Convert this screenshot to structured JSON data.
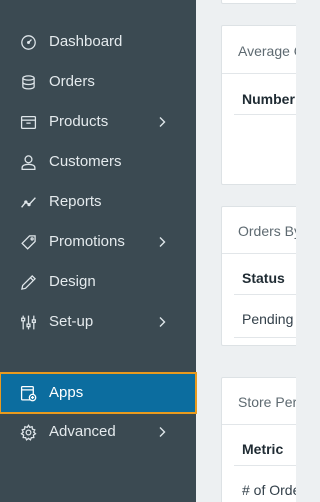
{
  "sidebar": {
    "items": [
      {
        "label": "Dashboard",
        "icon": "dashboard-icon",
        "has_submenu": false
      },
      {
        "label": "Orders",
        "icon": "orders-icon",
        "has_submenu": false
      },
      {
        "label": "Products",
        "icon": "products-icon",
        "has_submenu": true
      },
      {
        "label": "Customers",
        "icon": "customers-icon",
        "has_submenu": false
      },
      {
        "label": "Reports",
        "icon": "reports-icon",
        "has_submenu": false
      },
      {
        "label": "Promotions",
        "icon": "promotions-icon",
        "has_submenu": true
      },
      {
        "label": "Design",
        "icon": "design-icon",
        "has_submenu": false
      },
      {
        "label": "Set-up",
        "icon": "setup-icon",
        "has_submenu": true
      },
      {
        "label": "Apps",
        "icon": "apps-icon",
        "has_submenu": false,
        "active": true
      },
      {
        "label": "Advanced",
        "icon": "advanced-icon",
        "has_submenu": true
      }
    ]
  },
  "main": {
    "cards": [
      {
        "title": "Average O",
        "column_header": "Number"
      },
      {
        "title": "Orders By",
        "column_header": "Status",
        "rows": [
          "Pending"
        ]
      },
      {
        "title": "Store Per",
        "column_header": "Metric",
        "rows": [
          "# of Orde"
        ]
      }
    ]
  },
  "colors": {
    "sidebar_bg": "#3b4a52",
    "active_bg": "#0c6d9f",
    "active_outline": "#e99a1e",
    "content_bg": "#edf0f2"
  }
}
